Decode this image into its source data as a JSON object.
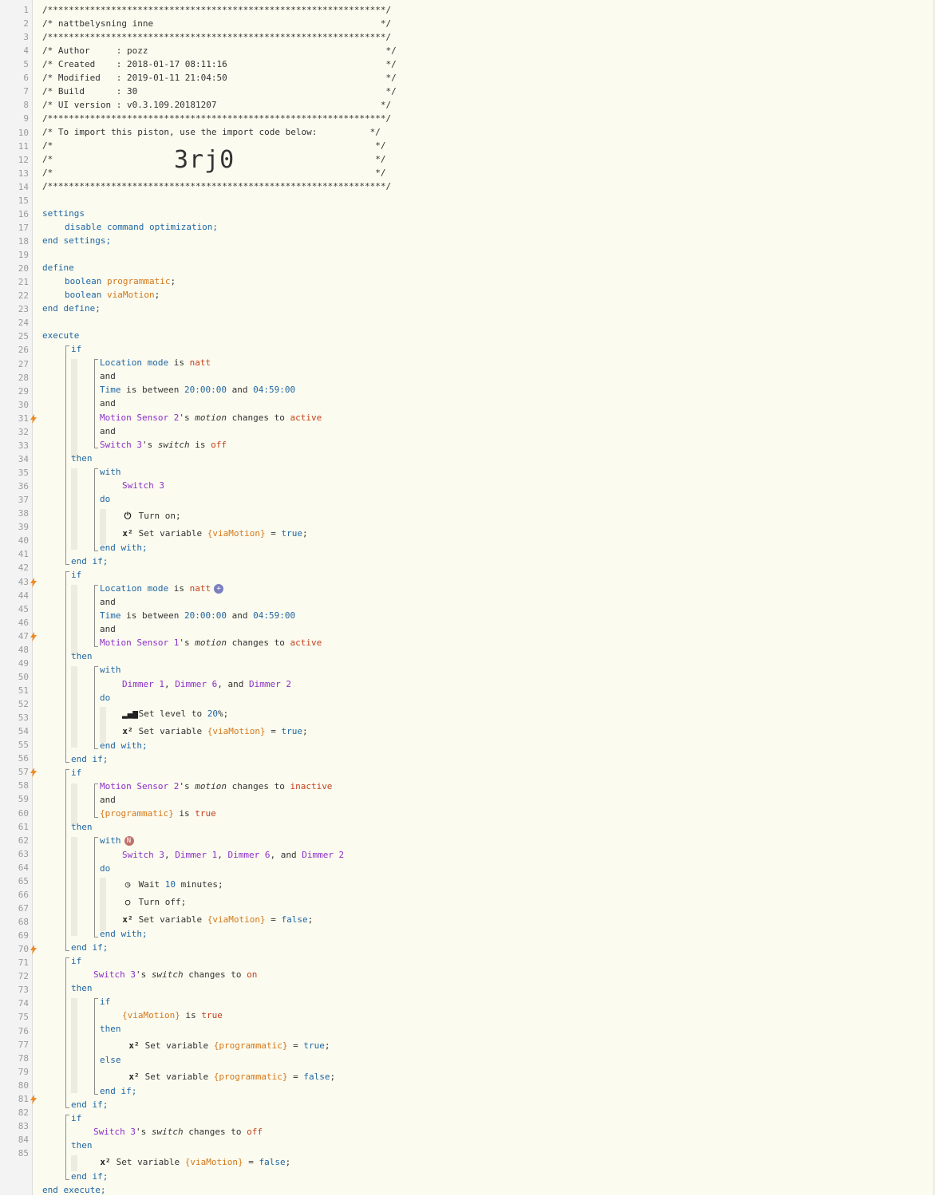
{
  "header": {
    "border": "/****************************************************************/",
    "title": "/* nattbelysning inne                                           */",
    "author": "/* Author     : pozz                                             */",
    "created": "/* Created    : 2018-01-17 08:11:16                              */",
    "modified": "/* Modified   : 2019-01-11 21:04:50                              */",
    "build": "/* Build      : 30                                               */",
    "ui_version": "/* UI version : v0.3.109.20181207                               */",
    "import_text": "/* To import this piston, use the import code below:          */",
    "blank": "/*                                                             */",
    "import_code": "3rj0"
  },
  "colors": {
    "keyword": "#1f66a3",
    "device": "#8b2fc9",
    "value": "#c5401d",
    "variable": "#d4781b",
    "trigger": "#f08a24"
  },
  "trigger_lines": [
    31,
    43,
    47,
    57,
    70,
    81
  ],
  "icons": {
    "power": "power-icon",
    "set_variable": "x2-variable-icon",
    "level": "signal-level-icon",
    "wait": "clock-icon",
    "off": "power-off-icon"
  },
  "code": {
    "l16": "settings",
    "l17": "disable command optimization;",
    "l18": "end settings;",
    "l20": "define",
    "l21a": "boolean",
    "l21b": "programmatic",
    "l22a": "boolean",
    "l22b": "viaMotion",
    "l23": "end define;",
    "l25": "execute",
    "if": "if",
    "and": "and",
    "then": "then",
    "else": "else",
    "with": "with",
    "do": "do",
    "end_with": "end with;",
    "end_if": "end if;",
    "end_execute": "end execute;",
    "location": "Location mode",
    "is": "is",
    "natt": "natt",
    "time": "Time",
    "between": "is between",
    "t1": "20:00:00",
    "t2": "04:59:00",
    "ms2": "Motion Sensor 2",
    "ms1": "Motion Sensor 1",
    "motion": "motion",
    "changes_to": "changes to",
    "active": "active",
    "inactive": "inactive",
    "switch3": "Switch 3",
    "switch": "switch",
    "off": "off",
    "on": "on",
    "turn_on": "Turn on;",
    "turn_off": "Turn off;",
    "set_variable": "Set variable",
    "viaMotion": "{viaMotion}",
    "programmatic": "{programmatic}",
    "true": "true",
    "false": "false",
    "dimmer1": "Dimmer 1",
    "dimmer6": "Dimmer 6",
    "dimmer2": "Dimmer 2",
    "set_level": "Set level to",
    "pct": "20",
    "wait": "Wait",
    "ten": "10",
    "minutes": "minutes;",
    "n_badge": "N",
    "plus_badge": "+"
  }
}
